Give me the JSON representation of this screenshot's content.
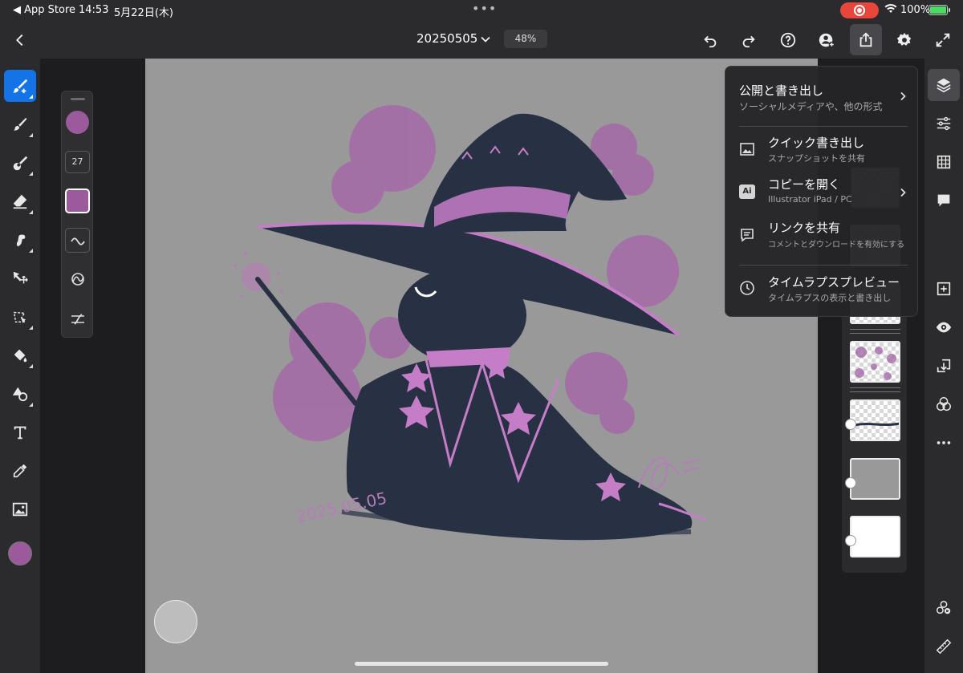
{
  "status_bar": {
    "back_app": "◀ App Store",
    "time": "14:53",
    "date": "5月22日(木)",
    "battery": "100%"
  },
  "top_bar": {
    "document_title": "20250505",
    "zoom": "48%"
  },
  "brush_panel": {
    "size": "27"
  },
  "colors": {
    "brush": "#9a5a9c",
    "canvas_bg": "#999999",
    "accent": "#1473e6",
    "recording": "#e8463b"
  },
  "share_menu": {
    "items": [
      {
        "title": "公開と書き出し",
        "subtitle": "ソーシャルメディアや、他の形式",
        "icon": "chevron-right-icon"
      },
      {
        "title": "クイック書き出し",
        "subtitle": "スナップショットを共有",
        "icon": "image-icon"
      },
      {
        "title": "コピーを開く",
        "subtitle": "Illustrator iPad / PC",
        "icon": "illustrator-icon"
      },
      {
        "title": "リンクを共有",
        "subtitle": "コメントとダウンロードを有効にする",
        "icon": "comment-icon"
      },
      {
        "title": "タイムラプスプレビュー",
        "subtitle": "タイムラプスの表示と書き出し",
        "icon": "clock-icon"
      }
    ]
  },
  "artwork": {
    "signature_date": "2025.05.05"
  }
}
